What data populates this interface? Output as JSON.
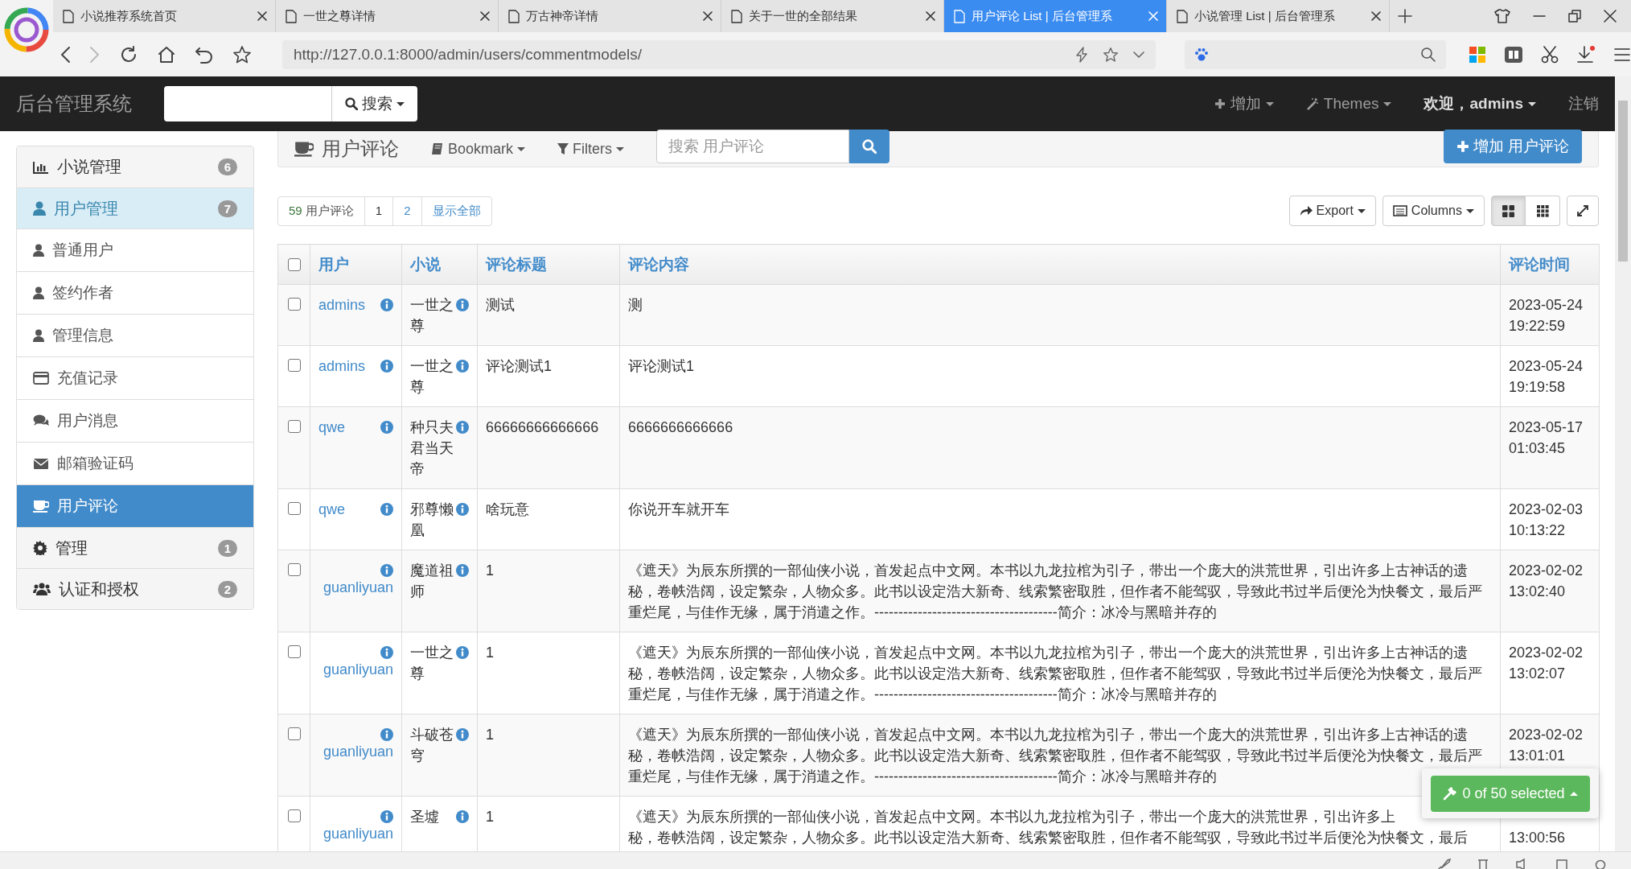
{
  "browser": {
    "tabs": [
      {
        "title": "小说推荐系统首页",
        "selected": false
      },
      {
        "title": "一世之尊详情",
        "selected": false
      },
      {
        "title": "万古神帝详情",
        "selected": false
      },
      {
        "title": "关于一世的全部结果",
        "selected": false
      },
      {
        "title": "用户评论 List | 后台管理系",
        "selected": true
      },
      {
        "title": "小说管理 List | 后台管理系",
        "selected": false
      }
    ],
    "address": "http://127.0.0.1:8000/admin/users/commentmodels/"
  },
  "navbar": {
    "brand": "后台管理系统",
    "search_button": "搜索",
    "add_menu": "增加",
    "themes_menu": "Themes",
    "user_menu": "欢迎，admins",
    "logout": "注销"
  },
  "sidebar": {
    "items": [
      {
        "kind": "group",
        "label": "小说管理",
        "badge": "6",
        "expanded": false,
        "selected": false
      },
      {
        "kind": "group",
        "label": "用户管理",
        "badge": "7",
        "expanded": true,
        "selected": false
      },
      {
        "kind": "item",
        "label": "普通用户",
        "selected": false
      },
      {
        "kind": "item",
        "label": "签约作者",
        "selected": false
      },
      {
        "kind": "item",
        "label": "管理信息",
        "selected": false
      },
      {
        "kind": "item",
        "label": "充值记录",
        "selected": false
      },
      {
        "kind": "item",
        "label": "用户消息",
        "selected": false
      },
      {
        "kind": "item",
        "label": "邮箱验证码",
        "selected": false
      },
      {
        "kind": "item",
        "label": "用户评论",
        "selected": true
      },
      {
        "kind": "group",
        "label": "管理",
        "badge": "1",
        "expanded": false,
        "selected": false
      },
      {
        "kind": "group",
        "label": "认证和授权",
        "badge": "2",
        "expanded": false,
        "selected": false
      }
    ]
  },
  "header": {
    "title": "用户评论",
    "bookmark": "Bookmark",
    "filters": "Filters",
    "search_placeholder": "搜索 用户评论",
    "add_button": "增加 用户评论"
  },
  "pager": {
    "count": "59",
    "count_label": "用户评论",
    "pages": [
      {
        "label": "1",
        "selected": true
      },
      {
        "label": "2",
        "selected": false
      }
    ],
    "show_all": "显示全部"
  },
  "tools": {
    "export": "Export",
    "columns": "Columns",
    "views": [
      {
        "selected": true
      },
      {
        "selected": false
      }
    ]
  },
  "table": {
    "select_all": false,
    "columns": [
      "用户",
      "小说",
      "评论标题",
      "评论内容",
      "评论时间"
    ],
    "rows": [
      {
        "checked": false,
        "user": "admins",
        "novel": "一世之尊",
        "title": "测试",
        "content": "测",
        "date": "2023-05-24",
        "clock": "19:22:59"
      },
      {
        "checked": false,
        "user": "admins",
        "novel": "一世之尊",
        "title": "评论测试1",
        "content": "评论测试1",
        "date": "2023-05-24",
        "clock": "19:19:58"
      },
      {
        "checked": false,
        "user": "qwe",
        "novel": "种只夫君当天帝",
        "title": "66666666666666",
        "content": "6666666666666",
        "date": "2023-05-17",
        "clock": "01:03:45"
      },
      {
        "checked": false,
        "user": "qwe",
        "novel": "邪尊懒凰",
        "title": "啥玩意",
        "content": "你说开车就开车",
        "date": "2023-02-03",
        "clock": "10:13:22"
      },
      {
        "checked": false,
        "user": "guanliyuan",
        "novel": "魔道祖师",
        "title": "1",
        "content": "《遮天》为辰东所撰的一部仙侠小说，首发起点中文网。本书以九龙拉棺为引子，带出一个庞大的洪荒世界，引出许多上古神话的遗秘，卷帙浩阔，设定繁杂，人物众多。此书以设定浩大新奇、线索繁密取胜，但作者不能驾驭，导致此书过半后便沦为快餐文，最后严重烂尾，与佳作无缘，属于消遣之作。--------------------------------------简介：冰冷与黑暗并存的",
        "date": "2023-02-02",
        "clock": "13:02:40"
      },
      {
        "checked": false,
        "user": "guanliyuan",
        "novel": "一世之尊",
        "title": "1",
        "content": "《遮天》为辰东所撰的一部仙侠小说，首发起点中文网。本书以九龙拉棺为引子，带出一个庞大的洪荒世界，引出许多上古神话的遗秘，卷帙浩阔，设定繁杂，人物众多。此书以设定浩大新奇、线索繁密取胜，但作者不能驾驭，导致此书过半后便沦为快餐文，最后严重烂尾，与佳作无缘，属于消遣之作。--------------------------------------简介：冰冷与黑暗并存的",
        "date": "2023-02-02",
        "clock": "13:02:07"
      },
      {
        "checked": false,
        "user": "guanliyuan",
        "novel": "斗破苍穹",
        "title": "1",
        "content": "《遮天》为辰东所撰的一部仙侠小说，首发起点中文网。本书以九龙拉棺为引子，带出一个庞大的洪荒世界，引出许多上古神话的遗秘，卷帙浩阔，设定繁杂，人物众多。此书以设定浩大新奇、线索繁密取胜，但作者不能驾驭，导致此书过半后便沦为快餐文，最后严重烂尾，与佳作无缘，属于消遣之作。--------------------------------------简介：冰冷与黑暗并存的",
        "date": "2023-02-02",
        "clock": "13:01:01"
      },
      {
        "checked": false,
        "user": "guanliyuan",
        "novel": "圣墟",
        "title": "1",
        "content_lines": [
          "《遮天》为辰东所撰的一部仙侠小说，首发起点中文网。本书以九龙拉棺为引子，带出一个庞大的洪荒世界，引出许多上",
          "秘，卷帙浩阔，设定繁杂，人物众多。此书以设定浩大新奇、线索繁密取胜，但作者不能驾驭，导致此书过半后便沦为快餐文，最后"
        ],
        "clock": "13:00:56"
      }
    ]
  },
  "actions": {
    "label": "0 of 50 selected"
  }
}
